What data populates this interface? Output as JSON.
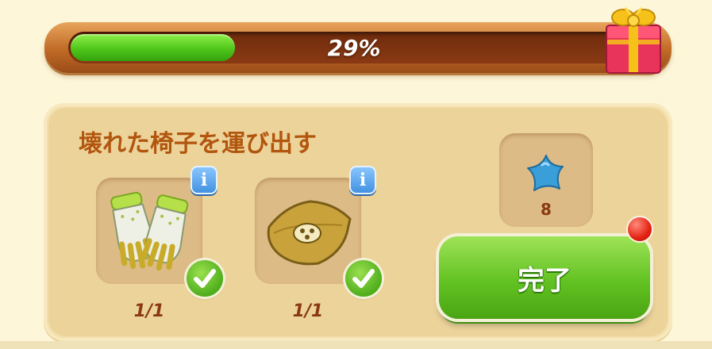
{
  "progress": {
    "percent_text": "29%",
    "fraction": 0.29
  },
  "task": {
    "title": "壊れた椅子を運び出す",
    "requirements": [
      {
        "icon": "gloves-icon",
        "count": "1/1",
        "completed": true
      },
      {
        "icon": "cloth-sack-icon",
        "count": "1/1",
        "completed": true
      }
    ],
    "reward": {
      "icon": "blue-star-icon",
      "amount": "8"
    },
    "complete_label": "完了"
  },
  "colors": {
    "title": "#b2560e",
    "progress_fill": "#4fc61a",
    "button": "#62c222",
    "notification": "#e42313"
  }
}
